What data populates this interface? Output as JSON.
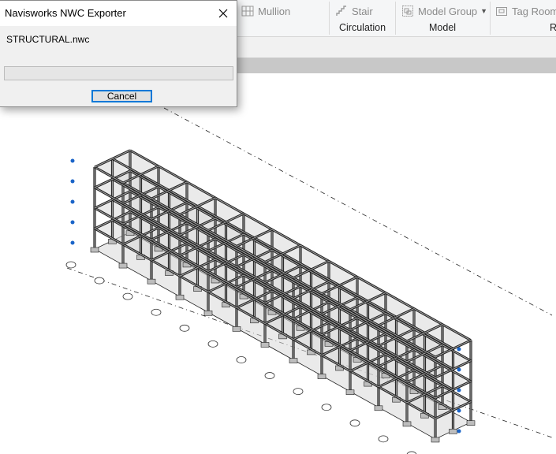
{
  "ribbon": {
    "mullion_label": "Mullion",
    "stair_label": "Stair",
    "model_group_label": "Model  Group",
    "tag_room_label": "Tag  Room",
    "panel_circulation": "Circulation",
    "panel_model": "Model",
    "panel_cut": "R"
  },
  "dialog": {
    "title": "Navisworks NWC Exporter",
    "filename": "STRUCTURAL.nwc",
    "progress": 0,
    "cancel_label": "Cancel"
  },
  "colors": {
    "progress_accent": "#06b025",
    "focus_border": "#0078d7",
    "frame_stroke": "#1f1f1f",
    "slab_fill": "#d9d9d9",
    "grid_bubble": "#1a64c8"
  },
  "icons": [
    "mullion-icon",
    "stair-icon",
    "model-group-icon",
    "tag-room-icon",
    "close-icon"
  ]
}
